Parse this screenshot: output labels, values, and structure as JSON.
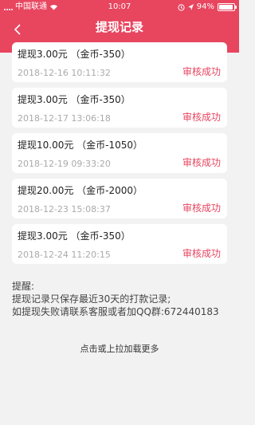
{
  "status_bar": {
    "carrier": "中国联通",
    "time": "10:07",
    "battery_percent": "94%",
    "battery_level": 0.94
  },
  "nav": {
    "title": "提现记录",
    "back_icon": "chevron-left-icon"
  },
  "records": [
    {
      "amount": "提现3.00元  （金币-350）",
      "date": "2018-12-16 10:11:32",
      "status": "审核成功"
    },
    {
      "amount": "提现3.00元  （金币-350）",
      "date": "2018-12-17 13:06:18",
      "status": "审核成功"
    },
    {
      "amount": "提现10.00元  （金币-1050）",
      "date": "2018-12-19 09:33:20",
      "status": "审核成功"
    },
    {
      "amount": "提现20.00元  （金币-2000）",
      "date": "2018-12-23 15:08:37",
      "status": "审核成功"
    },
    {
      "amount": "提现3.00元  （金币-350）",
      "date": "2018-12-24 11:20:15",
      "status": "审核成功"
    }
  ],
  "notice": {
    "title": "提醒:",
    "line1": "提现记录只保存最近30天的打款记录;",
    "line2": "如提现失败请联系客服或者加QQ群:672440183"
  },
  "load_more": "点击或上拉加载更多",
  "colors": {
    "accent": "#e8455f",
    "background": "#f2f2f2"
  }
}
